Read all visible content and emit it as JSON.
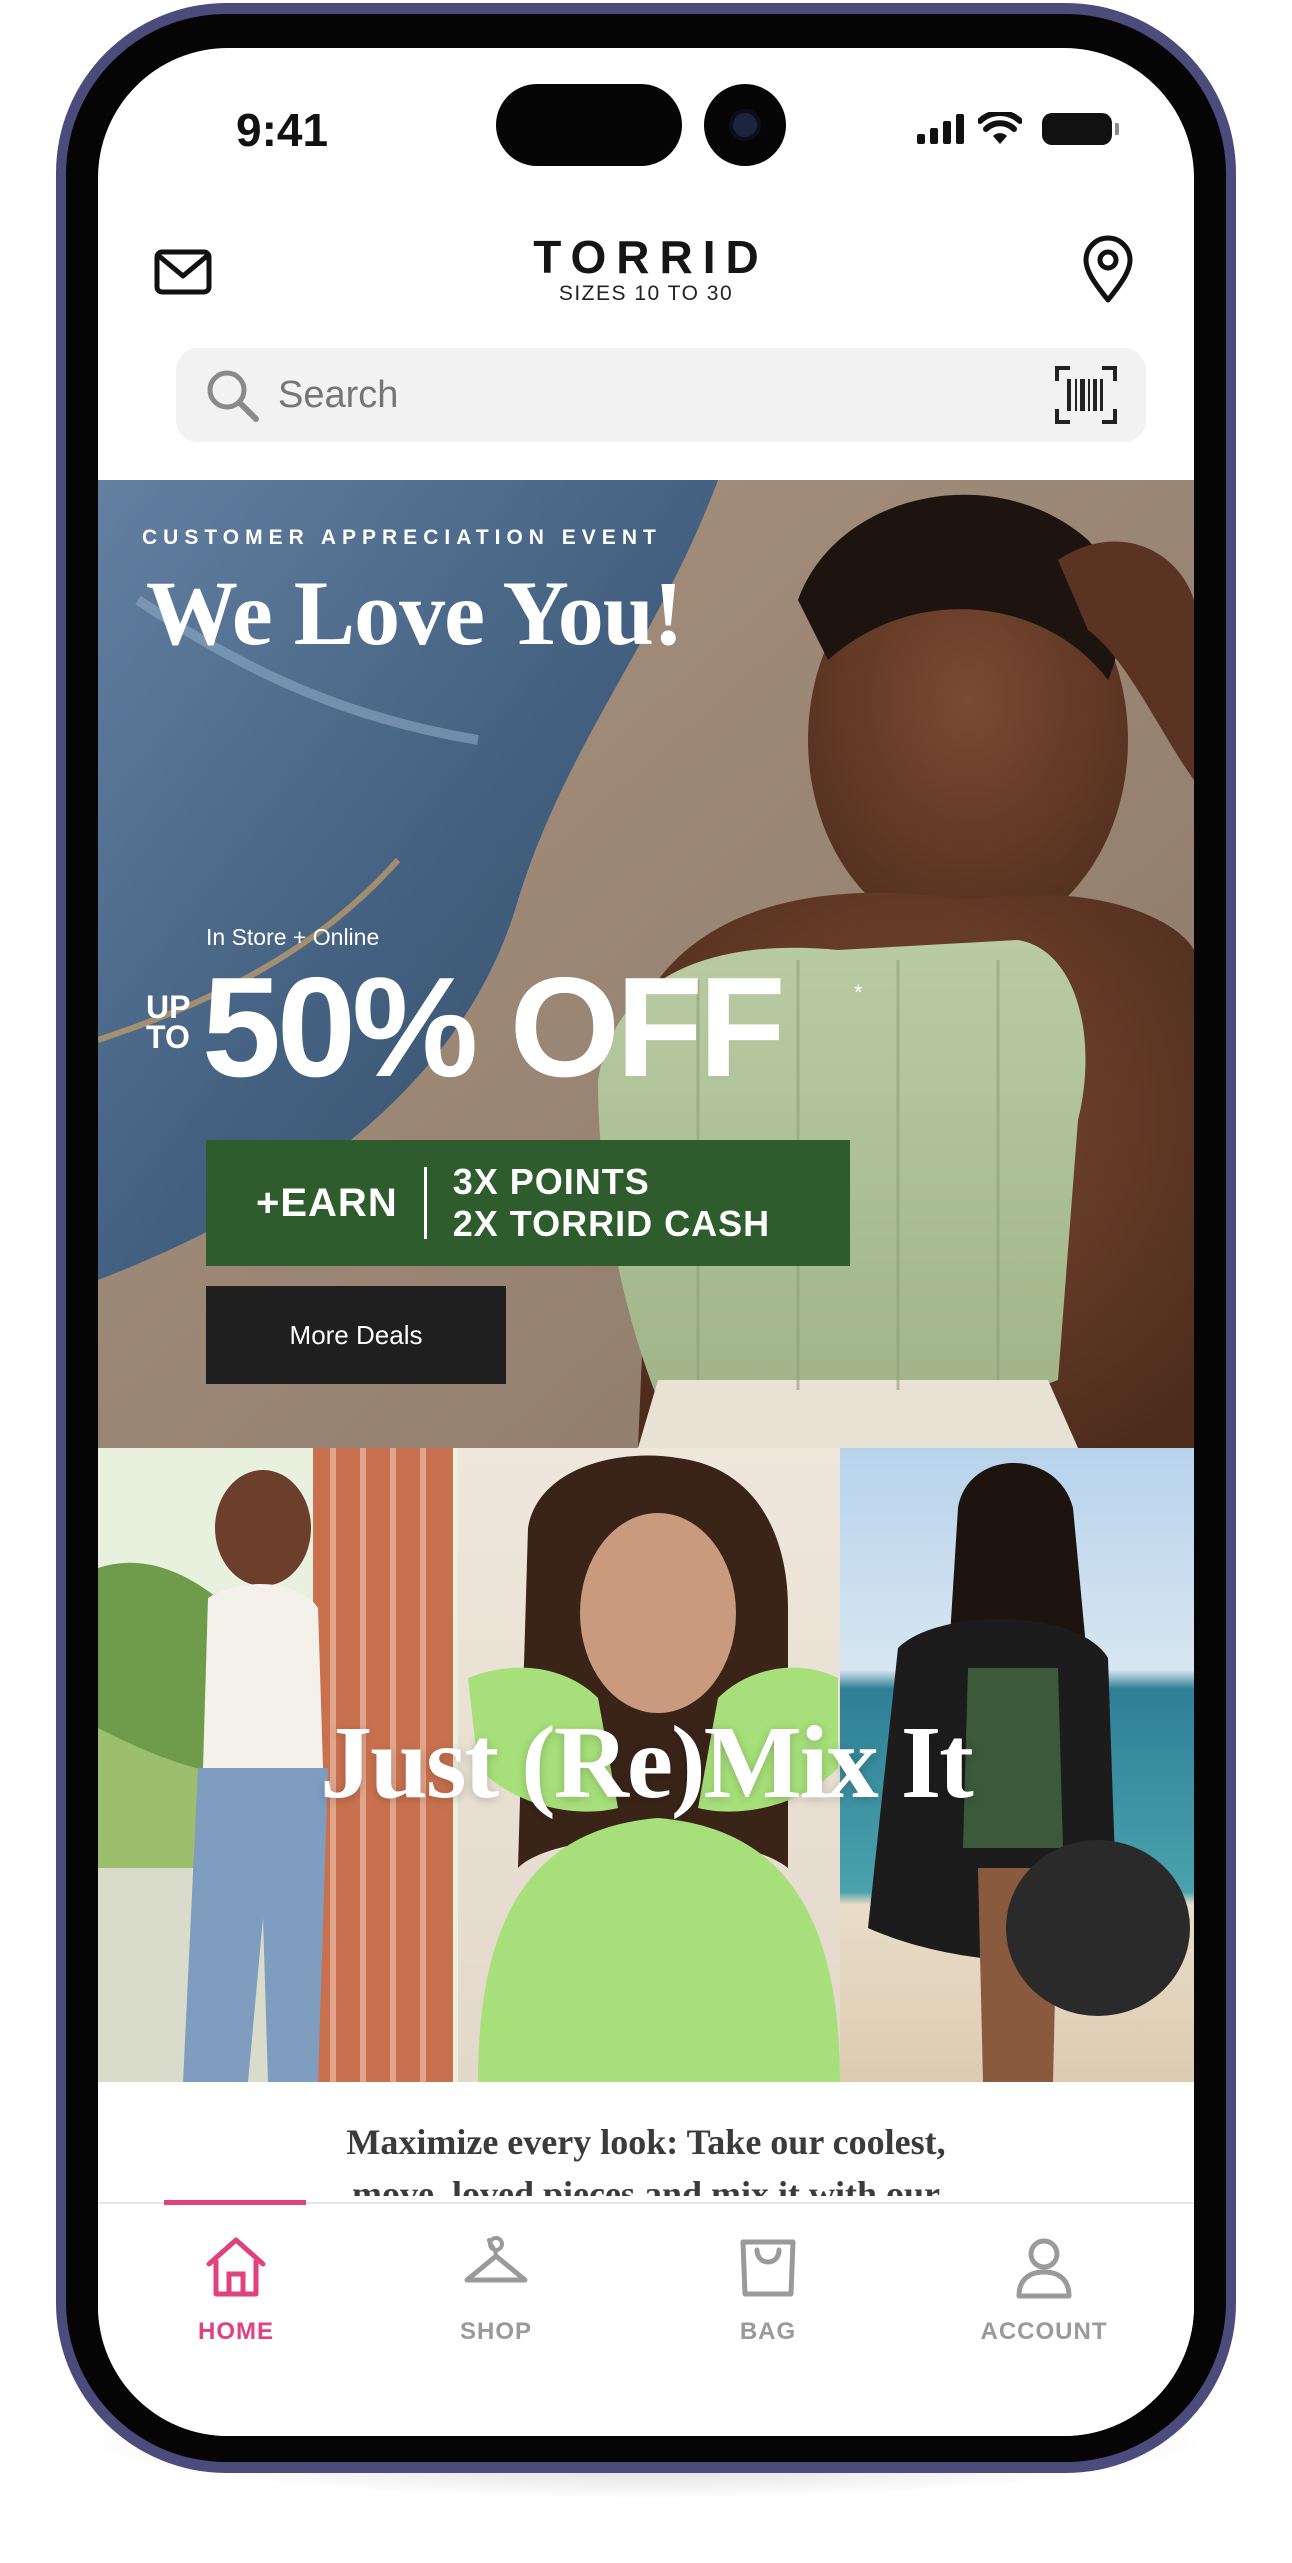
{
  "status_bar": {
    "time": "9:41"
  },
  "header": {
    "brand": "TORRID",
    "brand_sub": "SIZES 10 TO 30"
  },
  "search": {
    "placeholder": "Search"
  },
  "hero": {
    "eyebrow": "CUSTOMER APPRECIATION EVENT",
    "title": "We Love You!",
    "channel": "In Store + Online",
    "up_to_line1": "UP",
    "up_to_line2": "TO",
    "discount": "50% OFF",
    "asterisk": "*",
    "earn_label": "+EARN",
    "earn_line1": "3X POINTS",
    "earn_line2": "2X TORRID CASH",
    "cta": "More Deals",
    "accent_color": "#2f5c2c"
  },
  "collage": {
    "title": "Just (Re)Mix It"
  },
  "promo": {
    "text_line1": "Maximize every look: Take our coolest,",
    "text_line2": "move–loved pieces and mix it with our"
  },
  "tabbar": {
    "active_color": "#e0417f",
    "items": [
      {
        "label": "HOME",
        "icon": "home-icon",
        "active": true
      },
      {
        "label": "SHOP",
        "icon": "hanger-icon",
        "active": false
      },
      {
        "label": "BAG",
        "icon": "bag-icon",
        "active": false
      },
      {
        "label": "ACCOUNT",
        "icon": "account-icon",
        "active": false
      }
    ]
  }
}
